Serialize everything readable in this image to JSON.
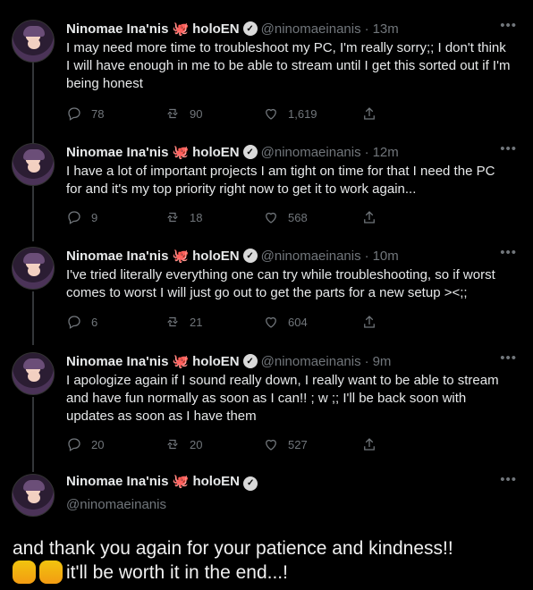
{
  "tweets": [
    {
      "name": "Ninomae Ina'nis",
      "brand": "holoEN",
      "handle": "@ninomaeinanis",
      "time": "13m",
      "text": "I may need more time to troubleshoot my PC, I'm really sorry;; I don't think I will have enough in me to be able to stream until I get this sorted out if I'm being honest",
      "replies": "78",
      "retweets": "90",
      "likes": "1,619"
    },
    {
      "name": "Ninomae Ina'nis",
      "brand": "holoEN",
      "handle": "@ninomaeinanis",
      "time": "12m",
      "text": "I have a lot of important projects I am tight on time for that I need the PC for and it's my top priority right now to get it to work again...",
      "replies": "9",
      "retweets": "18",
      "likes": "568"
    },
    {
      "name": "Ninomae Ina'nis",
      "brand": "holoEN",
      "handle": "@ninomaeinanis",
      "time": "10m",
      "text": "I've tried literally everything one can try while troubleshooting, so if worst comes to worst I will just go out to get the parts for a new setup ><;;",
      "replies": "6",
      "retweets": "21",
      "likes": "604"
    },
    {
      "name": "Ninomae Ina'nis",
      "brand": "holoEN",
      "handle": "@ninomaeinanis",
      "time": "9m",
      "text": "I apologize again if I sound really down, I really want to be able to stream and have fun normally as soon as I can!! ; w ;; I'll be back soon with updates as soon as I have them",
      "replies": "20",
      "retweets": "20",
      "likes": "527"
    }
  ],
  "last": {
    "name": "Ninomae Ina'nis",
    "brand": "holoEN",
    "handle": "@ninomaeinanis",
    "text_line1": "and thank you again for your patience and kindness!!",
    "text_line2": "it'll be worth it in the end...!"
  }
}
